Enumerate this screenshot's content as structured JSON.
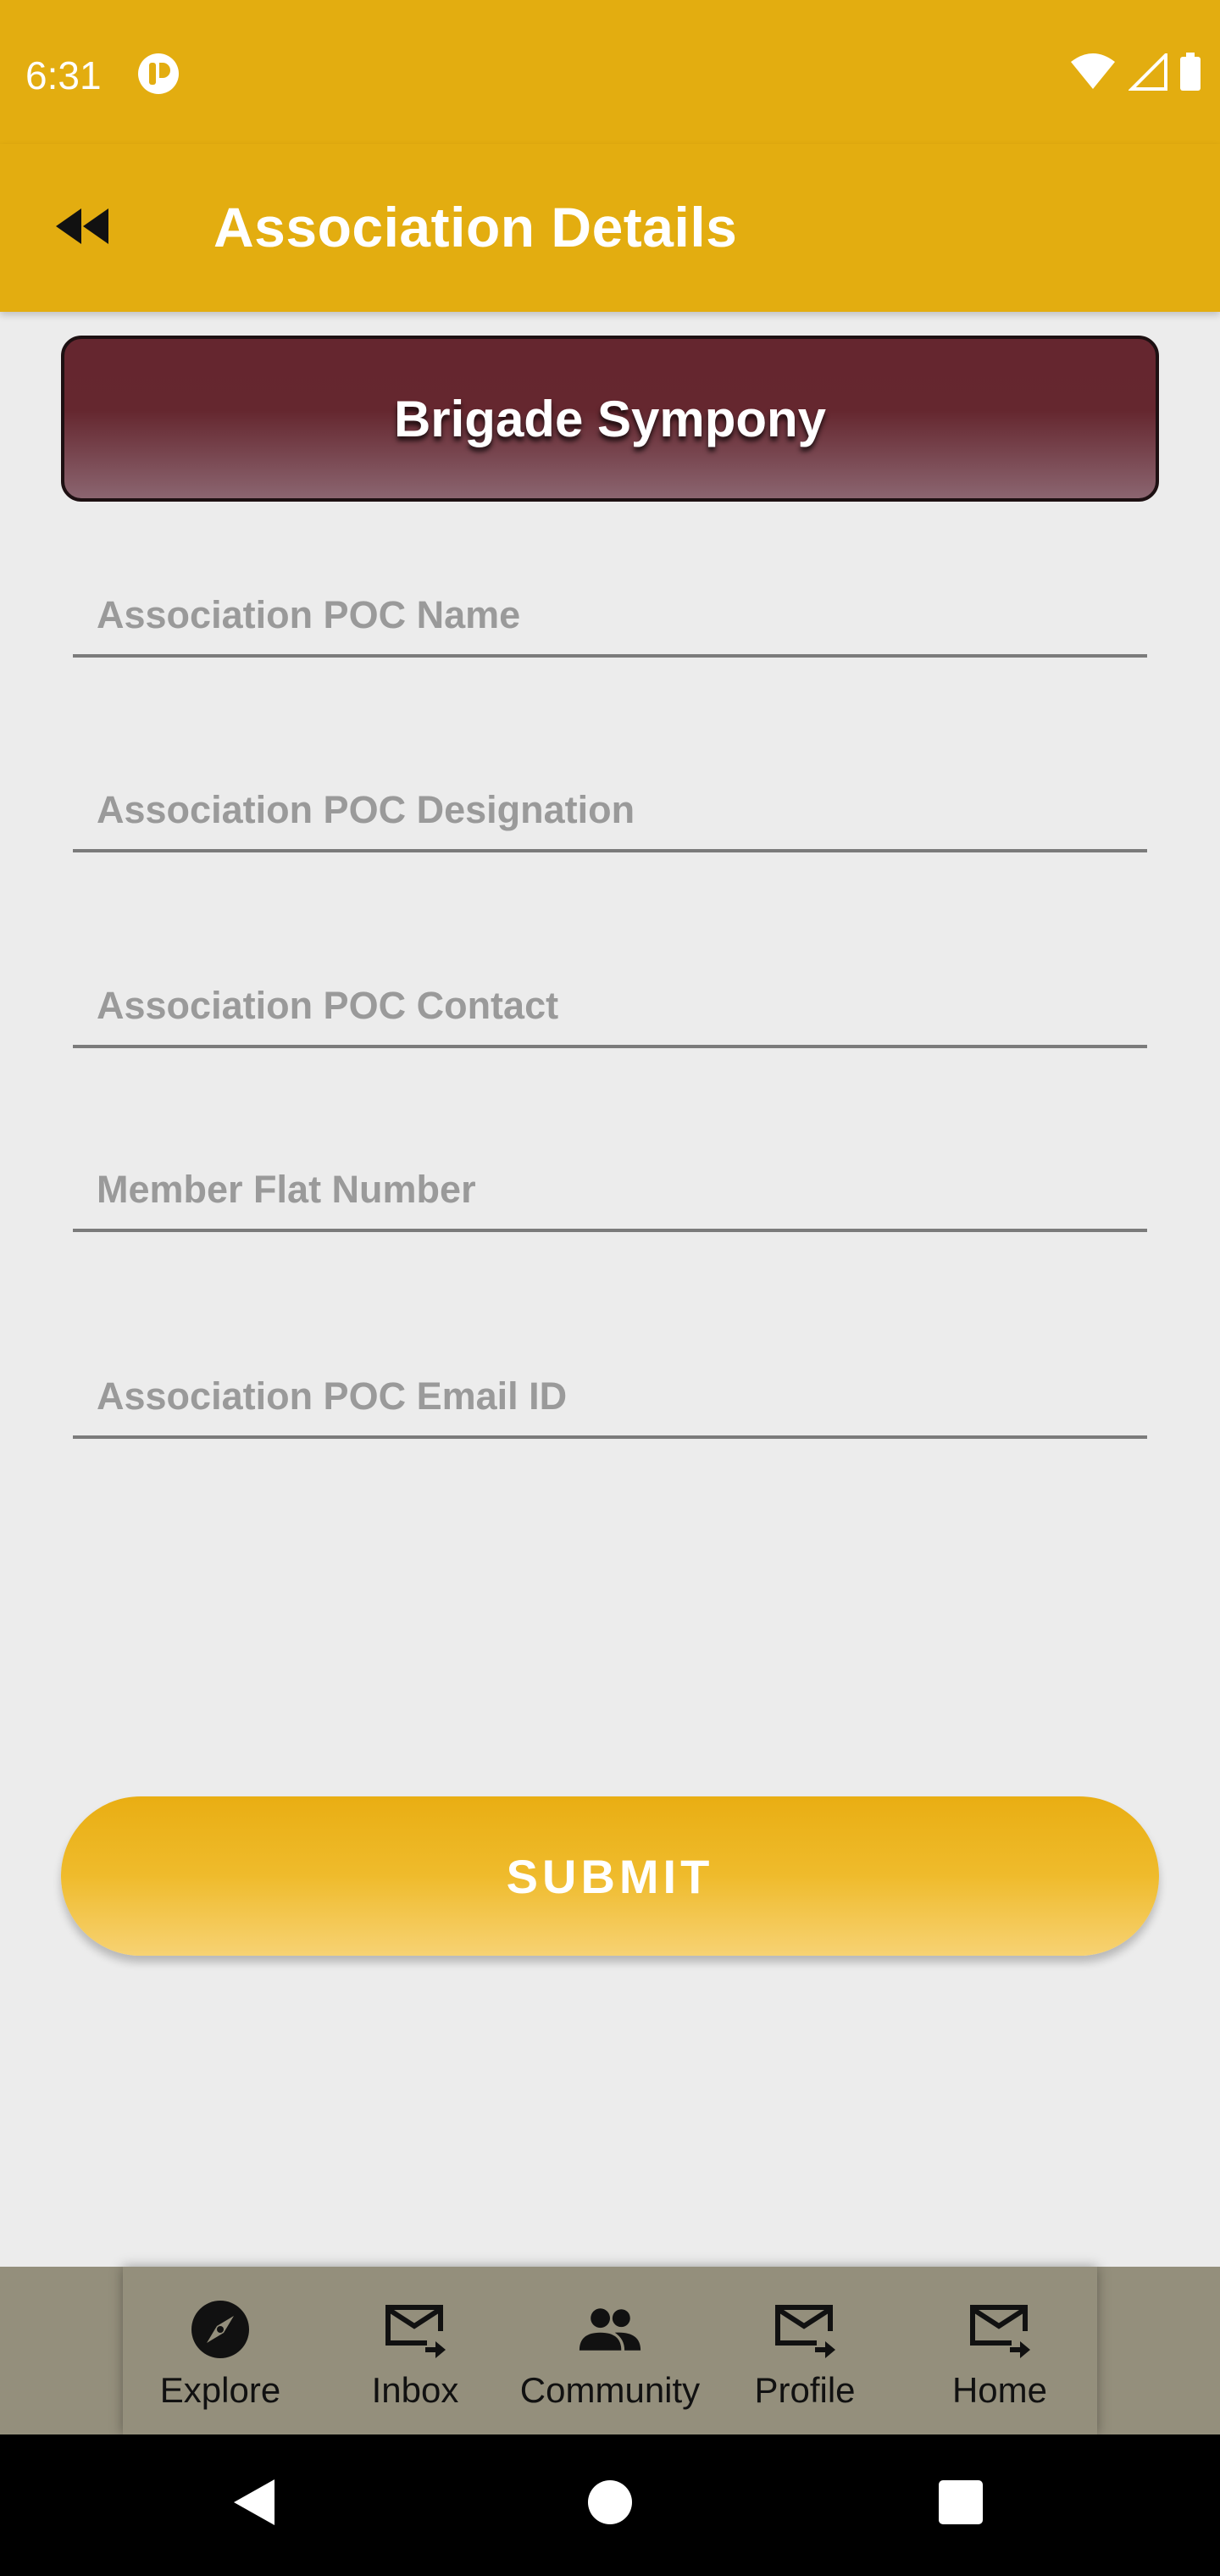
{
  "status_bar": {
    "time": "6:31",
    "icons": [
      "app-notification-icon",
      "wifi-icon",
      "cell-signal-icon",
      "battery-icon"
    ]
  },
  "app_bar": {
    "title": "Association Details",
    "back_icon": "rewind-back-icon"
  },
  "society": {
    "name": "Brigade Sympony"
  },
  "form": {
    "fields": [
      {
        "placeholder": "Association POC Name",
        "value": ""
      },
      {
        "placeholder": "Association POC Designation",
        "value": ""
      },
      {
        "placeholder": "Association POC Contact",
        "value": ""
      },
      {
        "placeholder": "Member Flat Number",
        "value": ""
      },
      {
        "placeholder": "Association POC Email ID",
        "value": ""
      }
    ],
    "submit_label": "SUBMIT"
  },
  "bottom_nav": {
    "items": [
      {
        "label": "Explore",
        "icon": "compass-icon"
      },
      {
        "label": "Inbox",
        "icon": "mail-forward-icon"
      },
      {
        "label": "Community",
        "icon": "people-icon"
      },
      {
        "label": "Profile",
        "icon": "mail-forward-icon"
      },
      {
        "label": "Home",
        "icon": "mail-forward-icon"
      }
    ]
  },
  "colors": {
    "app_bar": "#e3ad10",
    "banner": "#65262f",
    "background": "#ececec",
    "bottom_nav": "#948f7c"
  }
}
